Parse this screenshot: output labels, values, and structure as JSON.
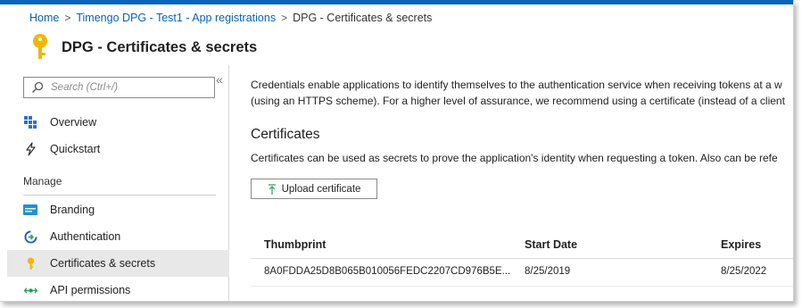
{
  "breadcrumb": {
    "home": "Home",
    "parent": "Timengo DPG - Test1 - App registrations",
    "current": "DPG - Certificates & secrets",
    "separator": ">"
  },
  "header": {
    "title": "DPG - Certificates & secrets"
  },
  "sidebar": {
    "search_placeholder": "Search (Ctrl+/)",
    "collapse_glyph": "«",
    "items": [
      {
        "label": "Overview",
        "icon": "overview-grid-icon"
      },
      {
        "label": "Quickstart",
        "icon": "quickstart-icon"
      }
    ],
    "section_title": "Manage",
    "manage_items": [
      {
        "label": "Branding",
        "icon": "branding-icon"
      },
      {
        "label": "Authentication",
        "icon": "authentication-icon"
      },
      {
        "label": "Certificates & secrets",
        "icon": "key-icon",
        "active": true
      },
      {
        "label": "API permissions",
        "icon": "api-permissions-icon"
      }
    ]
  },
  "main": {
    "description_line1": "Credentials enable applications to identify themselves to the authentication service when receiving tokens at a w",
    "description_line2": "(using an HTTPS scheme). For a higher level of assurance, we recommend using a certificate (instead of a client",
    "certificates_title": "Certificates",
    "certificates_desc": "Certificates can be used as secrets to prove the application's identity when requesting a token. Also can be refe",
    "upload_label": "Upload certificate",
    "table": {
      "columns": [
        "Thumbprint",
        "Start Date",
        "Expires"
      ],
      "rows": [
        [
          "8A0FDDA25D8B065B010056FEDC2207CD976B5E...",
          "8/25/2019",
          "8/25/2022"
        ]
      ]
    }
  },
  "colors": {
    "accent": "#0a64b9",
    "link": "#0a62b4",
    "key_gold": "#f2b600"
  }
}
